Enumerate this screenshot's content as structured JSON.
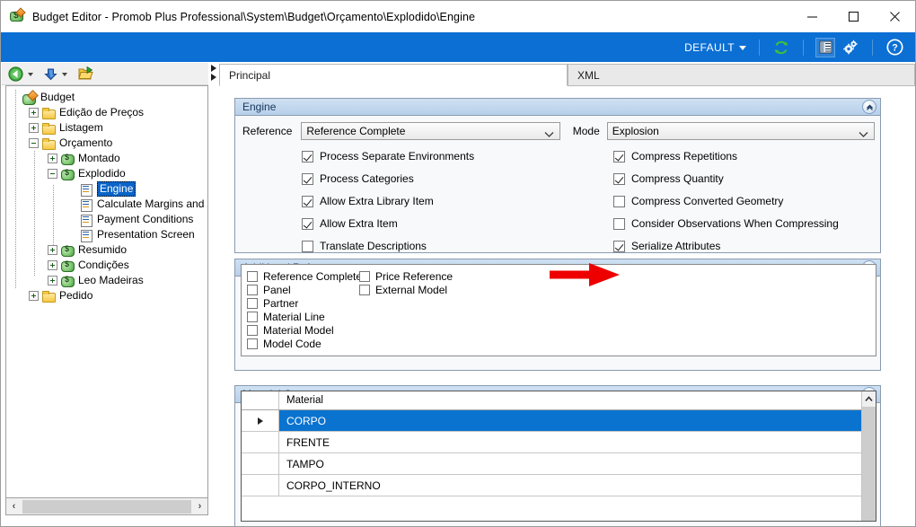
{
  "window": {
    "title": "Budget Editor - Promob Plus Professional\\System\\Budget\\Orçamento\\Explodido\\Engine",
    "app_icon": "money-tag-icon",
    "minimize_label": "–",
    "maximize_label": "□",
    "close_label": "✕"
  },
  "ribbon": {
    "profile_label": "DEFAULT",
    "buttons": [
      {
        "name": "refresh-icon",
        "title": "Refresh"
      },
      {
        "name": "layout-icon",
        "title": "Layout"
      },
      {
        "name": "settings-gears-icon",
        "title": "Settings"
      },
      {
        "name": "help-icon",
        "title": "Help"
      }
    ],
    "accent_color": "#0b6fd4"
  },
  "navbar": {
    "back_label": "Back",
    "forward_label": "Forward",
    "open_label": "Open"
  },
  "tree": {
    "items": [
      {
        "label": "Budget",
        "indent": 0,
        "icon": "root-money-tag-icon",
        "expander": "none",
        "selected": false
      },
      {
        "label": "Edição de Preços",
        "indent": 1,
        "icon": "folder-icon",
        "expander": "plus",
        "selected": false
      },
      {
        "label": "Listagem",
        "indent": 1,
        "icon": "folder-icon",
        "expander": "plus",
        "selected": false
      },
      {
        "label": "Orçamento",
        "indent": 1,
        "icon": "folder-icon",
        "expander": "minus",
        "selected": false
      },
      {
        "label": "Montado",
        "indent": 2,
        "icon": "money-icon",
        "expander": "plus",
        "selected": false
      },
      {
        "label": "Explodido",
        "indent": 2,
        "icon": "money-icon",
        "expander": "minus",
        "selected": false
      },
      {
        "label": "Engine",
        "indent": 3,
        "icon": "script-page-icon",
        "expander": "none",
        "selected": true
      },
      {
        "label": "Calculate Margins and Price",
        "indent": 3,
        "icon": "script-page-icon",
        "expander": "none",
        "selected": false
      },
      {
        "label": "Payment Conditions",
        "indent": 3,
        "icon": "script-page-icon",
        "expander": "none",
        "selected": false
      },
      {
        "label": "Presentation Screen",
        "indent": 3,
        "icon": "script-page-icon",
        "expander": "none",
        "selected": false
      },
      {
        "label": "Resumido",
        "indent": 2,
        "icon": "money-icon",
        "expander": "plus",
        "selected": false
      },
      {
        "label": "Condições",
        "indent": 2,
        "icon": "money-icon",
        "expander": "plus",
        "selected": false
      },
      {
        "label": "Leo Madeiras",
        "indent": 2,
        "icon": "money-icon",
        "expander": "plus",
        "selected": false
      },
      {
        "label": "Pedido",
        "indent": 1,
        "icon": "folder-icon",
        "expander": "plus",
        "selected": false
      }
    ]
  },
  "tabs": [
    {
      "label": "Principal",
      "active": true
    },
    {
      "label": "XML",
      "active": false
    }
  ],
  "engine": {
    "title": "Engine",
    "reference_label": "Reference",
    "reference_value": "Reference Complete",
    "mode_label": "Mode",
    "mode_value": "Explosion",
    "left_options": [
      {
        "label": "Process Separate Environments",
        "checked": true
      },
      {
        "label": "Process Categories",
        "checked": true
      },
      {
        "label": "Allow Extra Library Item",
        "checked": true
      },
      {
        "label": "Allow Extra Item",
        "checked": true
      },
      {
        "label": "Translate Descriptions",
        "checked": false
      }
    ],
    "right_options": [
      {
        "label": "Compress Repetitions",
        "checked": true
      },
      {
        "label": "Compress Quantity",
        "checked": true
      },
      {
        "label": "Compress Converted Geometry",
        "checked": false
      },
      {
        "label": "Consider Observations When Compressing",
        "checked": false
      },
      {
        "label": "Serialize Attributes",
        "checked": true
      }
    ]
  },
  "additional_references": {
    "title": "Additional References",
    "column1": [
      {
        "label": "Reference Complete",
        "checked": false
      },
      {
        "label": "Panel",
        "checked": false
      },
      {
        "label": "Partner",
        "checked": false
      },
      {
        "label": "Material Line",
        "checked": false
      },
      {
        "label": "Material Model",
        "checked": false
      },
      {
        "label": "Model Code",
        "checked": false
      }
    ],
    "column2": [
      {
        "label": "Price Reference",
        "checked": false
      },
      {
        "label": "External Model",
        "checked": false
      }
    ]
  },
  "material_components": {
    "title": "Material Components",
    "column_header": "Material",
    "rows": [
      {
        "value": "CORPO",
        "selected": true
      },
      {
        "value": "FRENTE",
        "selected": false
      },
      {
        "value": "TAMPO",
        "selected": false
      },
      {
        "value": "CORPO_INTERNO",
        "selected": false
      }
    ]
  },
  "annotation": {
    "arrow_color": "#ee0000",
    "points_at": "Serialize Attributes"
  },
  "colors": {
    "selection_blue": "#0a73d0",
    "ribbon_blue": "#0b6fd4",
    "group_header_blue": "#c3d8ee"
  }
}
